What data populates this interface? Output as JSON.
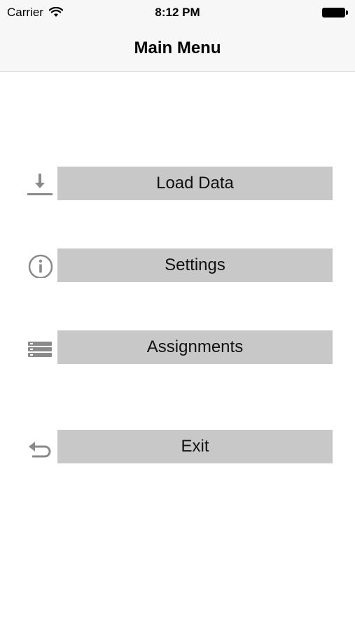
{
  "status_bar": {
    "carrier": "Carrier",
    "time": "8:12 PM",
    "wifi_icon": "wifi-icon",
    "battery_icon": "battery-icon"
  },
  "nav": {
    "title": "Main Menu"
  },
  "menu": {
    "items": [
      {
        "label": "Load Data",
        "icon": "download-icon"
      },
      {
        "label": "Settings",
        "icon": "info-icon"
      },
      {
        "label": "Assignments",
        "icon": "list-icon"
      },
      {
        "label": "Exit",
        "icon": "back-arrow-icon"
      }
    ]
  },
  "colors": {
    "button_bg": "#c8c8c8",
    "bar_bg": "#f7f7f7",
    "icon_gray": "#8a8a8a"
  }
}
